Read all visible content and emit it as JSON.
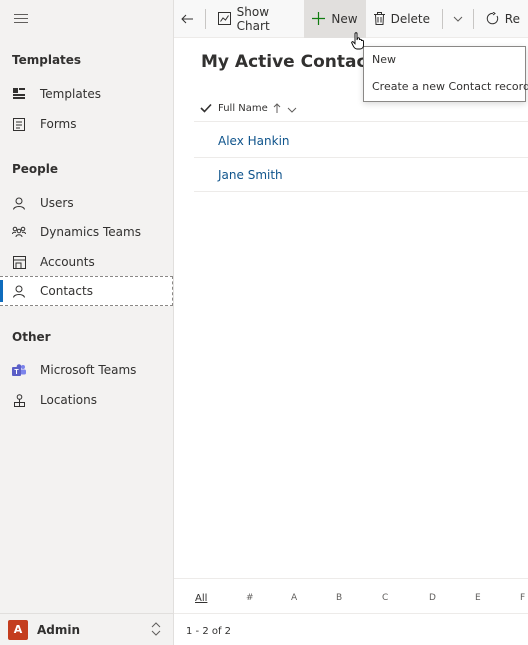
{
  "sidebar": {
    "groups": [
      {
        "title": "Templates",
        "items": [
          {
            "label": "Templates",
            "icon": "templates-icon"
          },
          {
            "label": "Forms",
            "icon": "forms-icon"
          }
        ]
      },
      {
        "title": "People",
        "items": [
          {
            "label": "Users",
            "icon": "user-icon"
          },
          {
            "label": "Dynamics Teams",
            "icon": "teams-icon"
          },
          {
            "label": "Accounts",
            "icon": "accounts-icon"
          },
          {
            "label": "Contacts",
            "icon": "contact-icon",
            "active": true
          }
        ]
      },
      {
        "title": "Other",
        "items": [
          {
            "label": "Microsoft Teams",
            "icon": "microsoft-teams-icon"
          },
          {
            "label": "Locations",
            "icon": "locations-icon"
          }
        ]
      }
    ],
    "footer": {
      "avatar_initial": "A",
      "label": "Admin"
    }
  },
  "toolbar": {
    "show_chart": "Show Chart",
    "new": "New",
    "delete": "Delete",
    "refresh": "Re"
  },
  "tooltip": {
    "title": "New",
    "body": "Create a new Contact record."
  },
  "view": {
    "title": "My Active Contacts",
    "column": "Full Name",
    "rows": [
      "Alex Hankin",
      "Jane Smith"
    ]
  },
  "alphabet": [
    "All",
    "#",
    "A",
    "B",
    "C",
    "D",
    "E",
    "F"
  ],
  "status": "1 - 2 of 2",
  "colors": {
    "accent": "#0f6cbd",
    "link": "#0f548c",
    "avatar": "#c43d1e",
    "teams": "#5b5fc7"
  }
}
